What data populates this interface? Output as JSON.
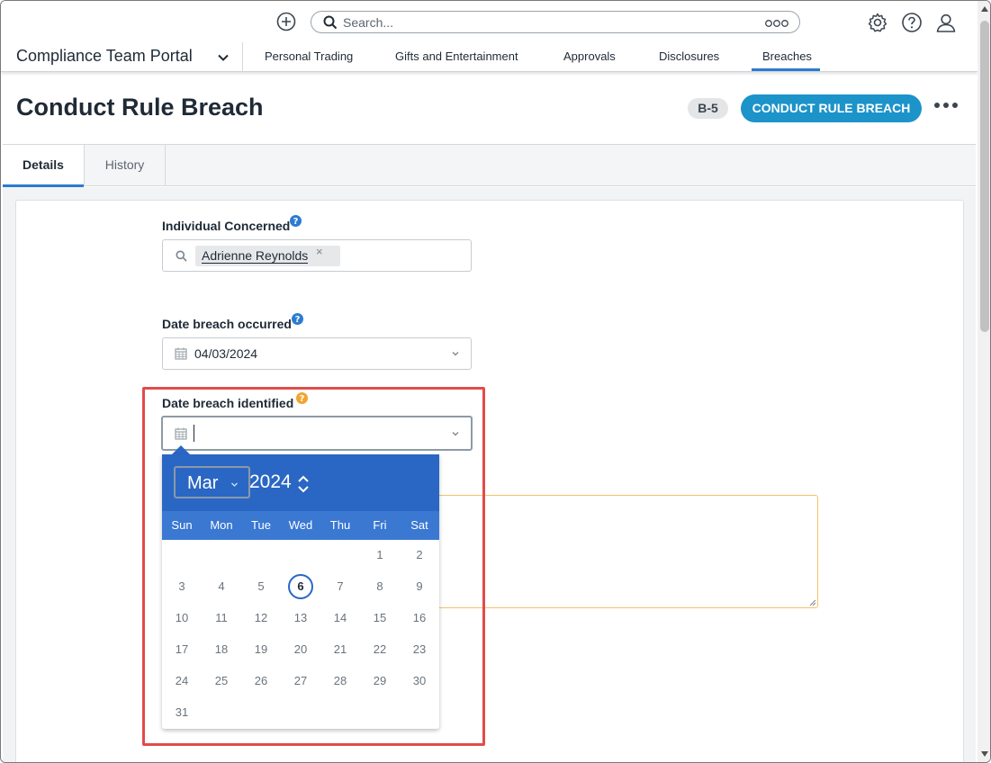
{
  "topbar": {
    "search_placeholder": "Search...",
    "icons": [
      "add-icon",
      "search-icon",
      "more-icon",
      "settings-icon",
      "help-icon",
      "user-icon"
    ]
  },
  "nav": {
    "portal_name": "Compliance Team Portal",
    "tabs": [
      {
        "label": "Personal Trading"
      },
      {
        "label": "Gifts and Entertainment"
      },
      {
        "label": "Approvals"
      },
      {
        "label": "Disclosures"
      },
      {
        "label": "Breaches",
        "active": true
      }
    ]
  },
  "header": {
    "title": "Conduct Rule Breach",
    "badge": "B-5",
    "primary_button": "CONDUCT RULE BREACH"
  },
  "tabs": [
    {
      "label": "Details",
      "active": true
    },
    {
      "label": "History",
      "active": false
    }
  ],
  "form": {
    "individual": {
      "label": "Individual Concerned",
      "chip": "Adrienne Reynolds",
      "chip_remove": "×"
    },
    "date_occurred": {
      "label": "Date breach occurred",
      "value": "04/03/2024"
    },
    "date_identified": {
      "label": "Date breach identified",
      "value": ""
    }
  },
  "calendar": {
    "month": "Mar",
    "year": "2024",
    "weekdays": [
      "Sun",
      "Mon",
      "Tue",
      "Wed",
      "Thu",
      "Fri",
      "Sat"
    ],
    "days": [
      "1",
      "2",
      "3",
      "4",
      "5",
      "6",
      "7",
      "8",
      "9",
      "10",
      "11",
      "12",
      "13",
      "14",
      "15",
      "16",
      "17",
      "18",
      "19",
      "20",
      "21",
      "22",
      "23",
      "24",
      "25",
      "26",
      "27",
      "28",
      "29",
      "30",
      "31"
    ],
    "first_weekday_index": 5,
    "today": "6"
  },
  "colors": {
    "accent": "#2b7bd1",
    "primary_button": "#1c93c9",
    "calendar_header": "#2a67c4",
    "highlight": "#e24b4b",
    "help_blue": "#2b7bd1",
    "help_orange": "#f0a531"
  }
}
